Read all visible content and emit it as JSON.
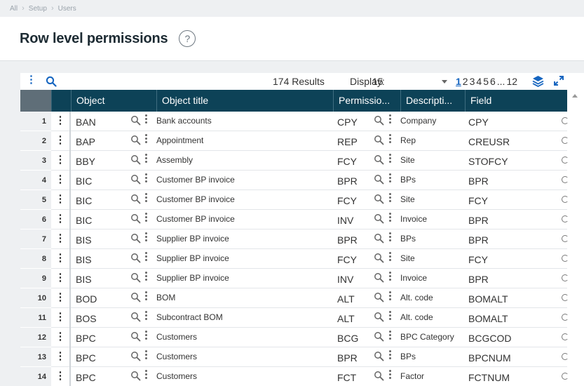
{
  "breadcrumb": [
    "All",
    "Setup",
    "Users"
  ],
  "page": {
    "title": "Row level permissions",
    "help_glyph": "?"
  },
  "toolbar": {
    "results": "174 Results",
    "display_label": "Display:",
    "display_value": "15",
    "pages": [
      "1",
      "2",
      "3",
      "4",
      "5",
      "6",
      "...",
      "12"
    ],
    "current_page": "1"
  },
  "columns": [
    "Object",
    "Object title",
    "Permissio...",
    "Descripti...",
    "Field"
  ],
  "rows": [
    {
      "num": "1",
      "object": "BAN",
      "title": "Bank accounts",
      "perm": "CPY",
      "desc": "Company",
      "field": "CPY"
    },
    {
      "num": "2",
      "object": "BAP",
      "title": "Appointment",
      "perm": "REP",
      "desc": "Rep",
      "field": "CREUSR"
    },
    {
      "num": "3",
      "object": "BBY",
      "title": "Assembly",
      "perm": "FCY",
      "desc": "Site",
      "field": "STOFCY"
    },
    {
      "num": "4",
      "object": "BIC",
      "title": "Customer BP invoice",
      "perm": "BPR",
      "desc": "BPs",
      "field": "BPR"
    },
    {
      "num": "5",
      "object": "BIC",
      "title": "Customer BP invoice",
      "perm": "FCY",
      "desc": "Site",
      "field": "FCY"
    },
    {
      "num": "6",
      "object": "BIC",
      "title": "Customer BP invoice",
      "perm": "INV",
      "desc": "Invoice",
      "field": "BPR"
    },
    {
      "num": "7",
      "object": "BIS",
      "title": "Supplier BP invoice",
      "perm": "BPR",
      "desc": "BPs",
      "field": "BPR"
    },
    {
      "num": "8",
      "object": "BIS",
      "title": "Supplier BP invoice",
      "perm": "FCY",
      "desc": "Site",
      "field": "FCY"
    },
    {
      "num": "9",
      "object": "BIS",
      "title": "Supplier BP invoice",
      "perm": "INV",
      "desc": "Invoice",
      "field": "BPR"
    },
    {
      "num": "10",
      "object": "BOD",
      "title": "BOM",
      "perm": "ALT",
      "desc": "Alt. code",
      "field": "BOMALT"
    },
    {
      "num": "11",
      "object": "BOS",
      "title": "Subcontract BOM",
      "perm": "ALT",
      "desc": "Alt. code",
      "field": "BOMALT"
    },
    {
      "num": "12",
      "object": "BPC",
      "title": "Customers",
      "perm": "BCG",
      "desc": "BPC Category",
      "field": "BCGCOD"
    },
    {
      "num": "13",
      "object": "BPC",
      "title": "Customers",
      "perm": "BPR",
      "desc": "BPs",
      "field": "BPCNUM"
    },
    {
      "num": "14",
      "object": "BPC",
      "title": "Customers",
      "perm": "FCT",
      "desc": "Factor",
      "field": "FCTNUM"
    }
  ],
  "icons": {
    "search": "magnifier-icon",
    "row_actions": "vertical-ellipsis-icon",
    "layers": "layers-icon",
    "expand": "expand-icon",
    "help": "question-circle-icon"
  },
  "colors": {
    "header_bg": "#0d4257",
    "accent": "#1565c0",
    "gutter": "#5f6e78"
  }
}
